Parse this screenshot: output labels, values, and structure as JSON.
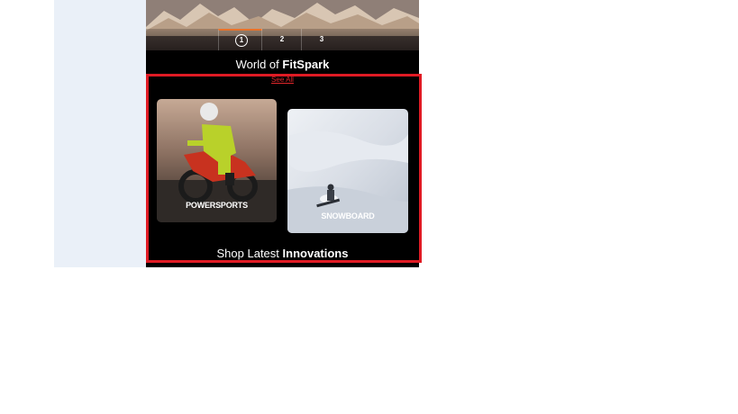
{
  "colors": {
    "accent": "#e01b24",
    "link": "#e0262a",
    "active_indicator": "#e8722a",
    "page_background": "#eaf0f8",
    "phone_background": "#000000"
  },
  "carousel": {
    "slides": [
      "1",
      "2",
      "3"
    ],
    "active_slide": "1"
  },
  "world_section": {
    "title_prefix": "World of",
    "title_brand": "FitSpark",
    "see_all_label": "See All"
  },
  "categories": [
    {
      "label": "POWERSPORTS",
      "icon": "motocross-rider-photo"
    },
    {
      "label": "SNOWBOARD",
      "icon": "snowboarder-photo"
    }
  ],
  "next_section": {
    "title_prefix": "Shop Latest",
    "title_bold": "Innovations"
  }
}
